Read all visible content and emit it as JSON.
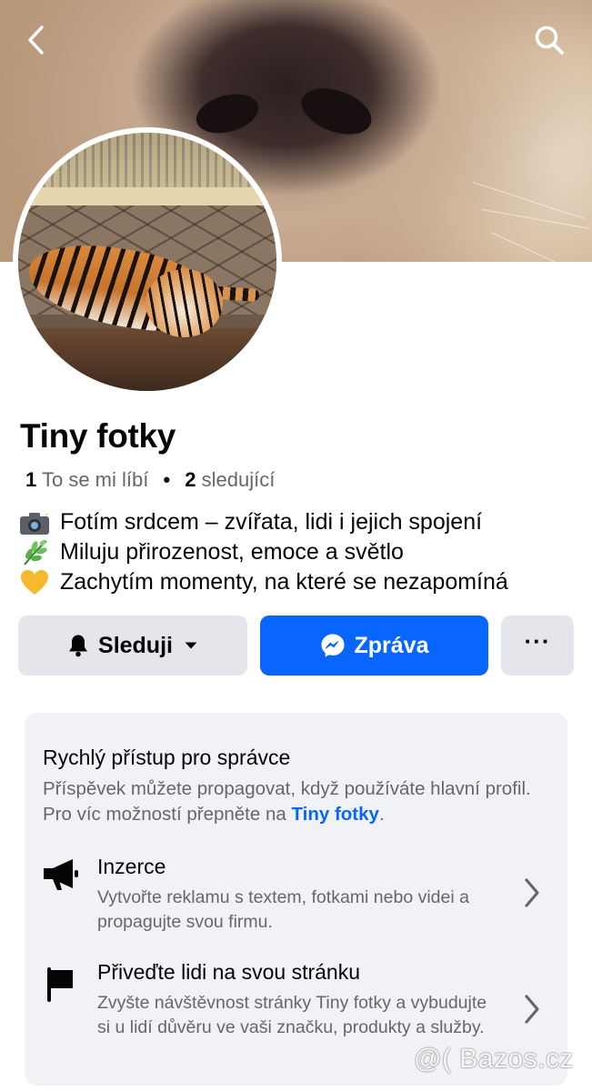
{
  "header": {
    "back_icon": "chevron-left-icon",
    "search_icon": "search-icon"
  },
  "profile": {
    "name": "Tiny fotky",
    "likes_count": "1",
    "likes_label": "To se mi líbí",
    "followers_count": "2",
    "followers_label": "sledující",
    "separator": "•"
  },
  "bio": [
    {
      "emoji": "camera-with-flash-icon",
      "text": "Fotím srdcem – zvířata, lidi i jejich spojení"
    },
    {
      "emoji": "herb-icon",
      "text": "Miluju přirozenost, emoce a světlo"
    },
    {
      "emoji": "yellow-heart-icon",
      "text": "Zachytím momenty, na které se nezapomíná"
    }
  ],
  "actions": {
    "follow_label": "Sleduji",
    "message_label": "Zpráva",
    "more_label": "···"
  },
  "admin_card": {
    "title": "Rychlý přístup pro správce",
    "desc_prefix": "Příspěvek můžete propagovat, když používáte hlavní profil. Pro víc možností přepněte na ",
    "desc_link": "Tiny fotky",
    "desc_suffix": ".",
    "items": [
      {
        "icon": "megaphone-icon",
        "title": "Inzerce",
        "desc": "Vytvořte reklamu s textem, fotkami nebo videi a propagujte svou firmu."
      },
      {
        "icon": "flag-icon",
        "title": "Přiveďte lidi na svou stránku",
        "desc": "Zvyšte návštěvnost stránky Tiny fotky a vybudujte si u lidí důvěru ve vaši značku, produkty a služby."
      }
    ]
  },
  "watermark": "@( Bazos.cz",
  "colors": {
    "accent": "#0866ff",
    "button_gray": "#e4e6eb",
    "card_bg": "#f0f2f5",
    "secondary_text": "#65676b"
  }
}
